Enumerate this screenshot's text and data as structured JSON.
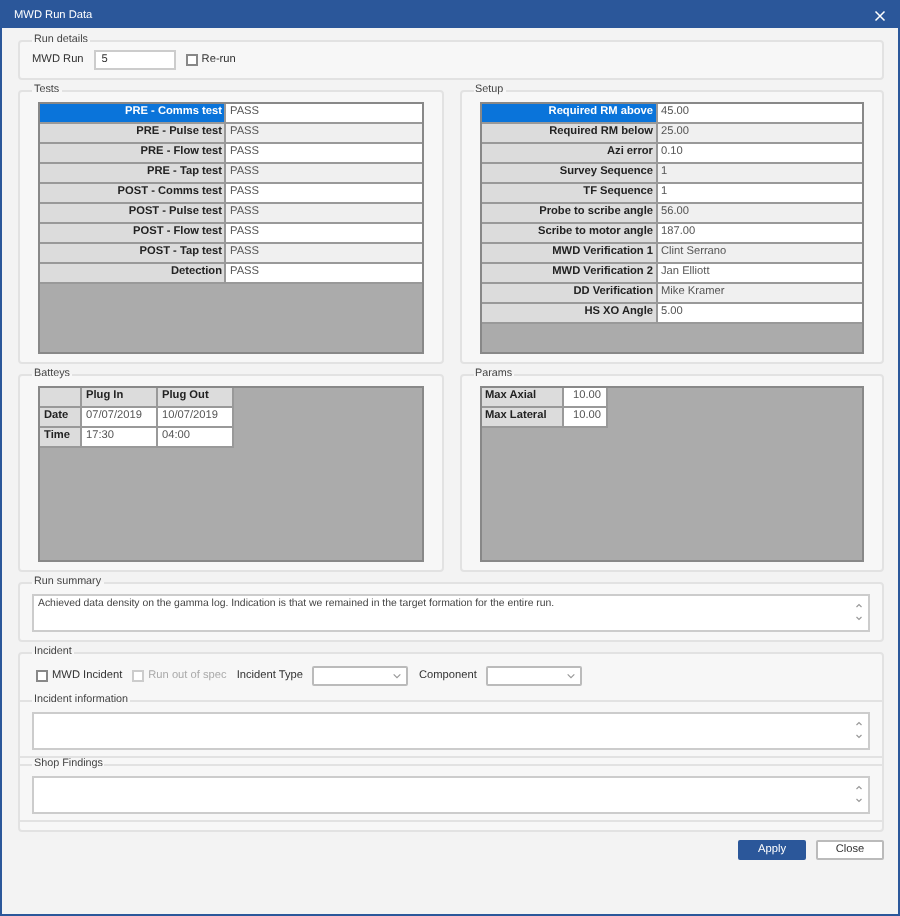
{
  "window": {
    "title": "MWD Run Data"
  },
  "run_details": {
    "title": "Run details",
    "mwd_run_label": "MWD Run",
    "mwd_run_value": "5",
    "rerun": {
      "label": "Re-run",
      "checked": false
    }
  },
  "tests": {
    "title": "Tests",
    "rows": [
      {
        "label": "PRE - Comms test",
        "value": "PASS",
        "selected": true
      },
      {
        "label": "PRE - Pulse test",
        "value": "PASS",
        "selected": false
      },
      {
        "label": "PRE - Flow test",
        "value": "PASS",
        "selected": false
      },
      {
        "label": "PRE - Tap test",
        "value": "PASS",
        "selected": false
      },
      {
        "label": "POST - Comms test",
        "value": "PASS",
        "selected": false
      },
      {
        "label": "POST - Pulse test",
        "value": "PASS",
        "selected": false
      },
      {
        "label": "POST - Flow test",
        "value": "PASS",
        "selected": false
      },
      {
        "label": "POST - Tap test",
        "value": "PASS",
        "selected": false
      },
      {
        "label": "Detection",
        "value": "PASS",
        "selected": false
      }
    ]
  },
  "setup": {
    "title": "Setup",
    "rows": [
      {
        "label": "Required RM above",
        "value": "45.00",
        "selected": true
      },
      {
        "label": "Required RM below",
        "value": "25.00",
        "selected": false
      },
      {
        "label": "Azi error",
        "value": "0.10",
        "selected": false
      },
      {
        "label": "Survey Sequence",
        "value": "1",
        "selected": false
      },
      {
        "label": "TF Sequence",
        "value": "1",
        "selected": false
      },
      {
        "label": "Probe to scribe angle",
        "value": "56.00",
        "selected": false
      },
      {
        "label": "Scribe to motor angle",
        "value": "187.00",
        "selected": false
      },
      {
        "label": "MWD Verification 1",
        "value": "Clint Serrano",
        "selected": false
      },
      {
        "label": "MWD Verification 2",
        "value": "Jan Elliott",
        "selected": false
      },
      {
        "label": "DD Verification",
        "value": "Mike Kramer",
        "selected": false
      },
      {
        "label": "HS XO Angle",
        "value": "5.00",
        "selected": false
      }
    ]
  },
  "batteries": {
    "title": "Batteys",
    "columns": [
      "Plug In",
      "Plug Out"
    ],
    "rows": [
      {
        "label": "Date",
        "cells": [
          "07/07/2019",
          "10/07/2019"
        ]
      },
      {
        "label": "Time",
        "cells": [
          "17:30",
          "04:00"
        ]
      }
    ]
  },
  "params": {
    "title": "Params",
    "rows": [
      {
        "label": "Max Axial",
        "value": "10.00"
      },
      {
        "label": "Max Lateral",
        "value": "10.00"
      }
    ]
  },
  "run_summary": {
    "title": "Run summary",
    "value": "Achieved data density on the gamma log. Indication is that we remained in the target formation for the entire run."
  },
  "incident": {
    "title": "Incident",
    "mwd_incident": {
      "label": "MWD Incident",
      "checked": false,
      "disabled": false
    },
    "run_out_of_spec": {
      "label": "Run out of spec",
      "checked": false,
      "disabled": true
    },
    "incident_type_label": "Incident Type",
    "component_label": "Component"
  },
  "incident_information": {
    "title": "Incident information"
  },
  "shop_findings": {
    "title": "Shop Findings"
  },
  "buttons": [
    {
      "label": "Apply",
      "kind": "primary"
    },
    {
      "label": "Close",
      "kind": "default"
    }
  ]
}
